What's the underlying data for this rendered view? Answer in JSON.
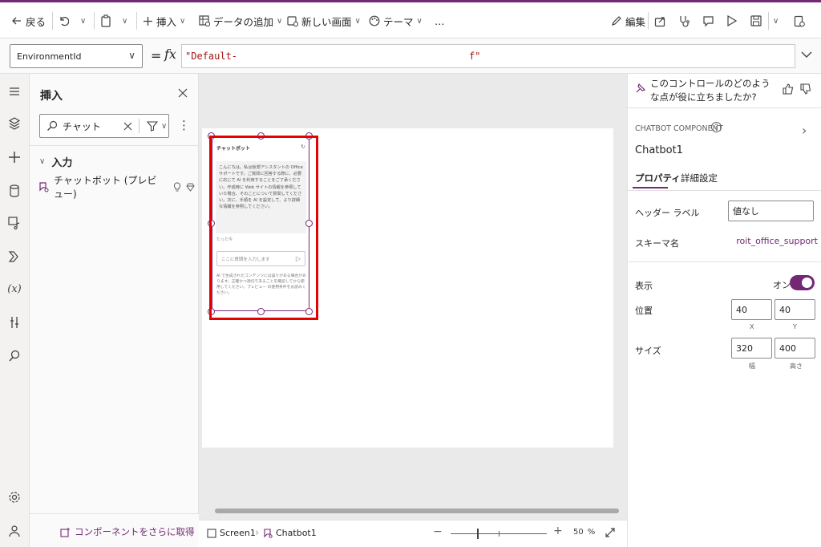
{
  "toolbar": {
    "back_label": "戻る",
    "insert_label": "挿入",
    "add_data_label": "データの追加",
    "new_screen_label": "新しい画面",
    "theme_label": "テーマ",
    "more_label": "…",
    "edit_label": "編集"
  },
  "formula_bar": {
    "property": "EnvironmentId",
    "equals": "=",
    "fx": "fx",
    "value": "\"Default-                                        f\""
  },
  "insert_pane": {
    "title": "挿入",
    "search_value": "チャット",
    "group_label": "入力",
    "item_label": "チャットボット (プレビュー)",
    "get_more_label": "コンポーネントをさらに取得"
  },
  "chatbot_preview": {
    "title": "チャットボット",
    "message": "こんにちは。私は仮想アシスタントの Officeサポートです。ご質問に回答する際に、必要に応じて AI を利用することをご了承ください。作成時に Web サイトの情報を参照していた場合、そのことについて質問してください。次に、手順を AI を設定して、より詳細な情報を参照してください。",
    "time": "たった今",
    "input_placeholder": "ここに質問を入力します",
    "footer": "AI で生成されたコンテンツには誤りがある場合があります。正確かつ適切であることを確認してから使用してください。プレビュー の使用条件をお読みください。"
  },
  "status_bar": {
    "screen_label": "Screen1",
    "chatbot_label": "Chatbot1",
    "zoom_minus": "−",
    "zoom_plus": "+",
    "zoom_value": "50",
    "zoom_unit": "%",
    "zoom_level": 0.5
  },
  "right_pane": {
    "feedback_question": "このコントロールのどのような点が役に立ちましたか?",
    "component_type": "CHATBOT COMPONENT",
    "component_name": "Chatbot1",
    "tab_properties": "プロパティ",
    "tab_advanced": "詳細設定",
    "header_label_name": "ヘッダー ラベル",
    "header_label_value": "値なし",
    "schema_name_label": "スキーマ名",
    "schema_name_value": "roit_office_support",
    "visible_label": "表示",
    "visible_state": "オン",
    "position_label": "位置",
    "pos_x": "40",
    "pos_y": "40",
    "x_label": "X",
    "y_label": "Y",
    "size_label": "サイズ",
    "width": "320",
    "height": "400",
    "width_label": "幅",
    "height_label": "高さ"
  },
  "colors": {
    "accent": "#742774",
    "selection": "#e60000"
  }
}
